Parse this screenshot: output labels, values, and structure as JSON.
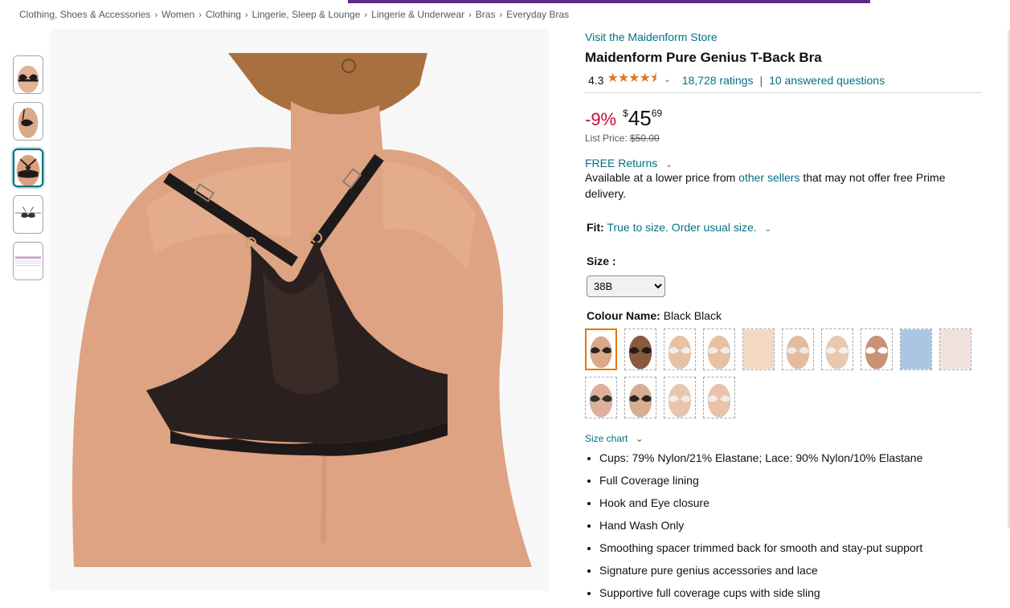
{
  "breadcrumb": [
    "Clothing, Shoes & Accessories",
    "Women",
    "Clothing",
    "Lingerie, Sleep & Lounge",
    "Lingerie & Underwear",
    "Bras",
    "Everyday Bras"
  ],
  "breadcrumb_sep": "›",
  "thumbnails": [
    {
      "kind": "front",
      "selected": false
    },
    {
      "kind": "side",
      "selected": false
    },
    {
      "kind": "back",
      "selected": true
    },
    {
      "kind": "detail",
      "selected": false
    },
    {
      "kind": "chart",
      "selected": false
    }
  ],
  "main_image": {
    "share_icon": "share-icon"
  },
  "product": {
    "store_link": "Visit the Maidenform Store",
    "title": "Maidenform Pure Genius T-Back Bra",
    "rating": "4.3",
    "stars": "★★★★⯨",
    "ratings_count": "18,728 ratings",
    "pipe": "|",
    "answered": "10 answered questions",
    "chevron": "⌄"
  },
  "price": {
    "discount": "-9%",
    "currency": "$",
    "whole": "45",
    "fraction": "69",
    "list_label": "List Price:",
    "list_value": "$50.00"
  },
  "returns": {
    "label": "FREE Returns",
    "chevron": "⌄"
  },
  "availability": {
    "prefix": "Available at a lower price from ",
    "link": "other sellers",
    "suffix": " that may not offer free Prime delivery."
  },
  "fit": {
    "label": "Fit:",
    "value": "True to size. Order usual size.",
    "chevron": "⌄"
  },
  "size": {
    "label": "Size :",
    "selected": "38B"
  },
  "colour": {
    "label": "Colour Name:",
    "value": "Black Black",
    "swatches": [
      {
        "tone": "#2b2424",
        "skin": "#d9a98a",
        "selected": true
      },
      {
        "tone": "#2a1a17",
        "skin": "#8a5a3e",
        "selected": false
      },
      {
        "tone": "#f2ece8",
        "skin": "#e6c1a3",
        "selected": false
      },
      {
        "tone": "#f2ece8",
        "skin": "#e6c1a3",
        "selected": false
      },
      {
        "tone": "#f3d9c4",
        "skin": "#f3d9c4",
        "selected": false
      },
      {
        "tone": "#efe9e6",
        "skin": "#e3bca0",
        "selected": false
      },
      {
        "tone": "#f3f1ef",
        "skin": "#e7c8b0",
        "selected": false
      },
      {
        "tone": "#ffffff",
        "skin": "#c99274",
        "selected": false
      },
      {
        "tone": "#a9c6e3",
        "skin": "#a9c6e3",
        "selected": false
      },
      {
        "tone": "#f2e0dc",
        "skin": "#f2e0dc",
        "selected": false
      },
      {
        "tone": "#353030",
        "skin": "#dcb09a",
        "selected": false
      },
      {
        "tone": "#2a2424",
        "skin": "#d8ad94",
        "selected": false
      },
      {
        "tone": "#f1ebe6",
        "skin": "#e8c6ad",
        "selected": false
      },
      {
        "tone": "#f4e9e3",
        "skin": "#e6c3a9",
        "selected": false
      }
    ]
  },
  "size_chart": {
    "label": "Size chart",
    "chevron": "⌄"
  },
  "bullets": [
    "Cups: 79% Nylon/21% Elastane; Lace: 90% Nylon/10% Elastane",
    "Full Coverage lining",
    "Hook and Eye closure",
    "Hand Wash Only",
    "Smoothing spacer trimmed back for smooth and stay-put support",
    "Signature pure genius accessories and lace",
    "Supportive full coverage cups with side sling"
  ]
}
